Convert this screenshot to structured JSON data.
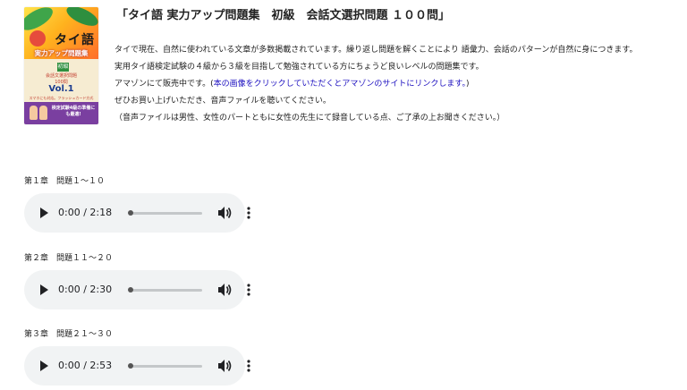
{
  "book": {
    "title_thai": "タイ語",
    "subtitle": "実力アップ問題集",
    "level": "初級",
    "description": "会話文選択問題",
    "count": "100問",
    "volume": "Vol.1",
    "note": "スマホにも対応。フラッシュカード方式",
    "band_text": "検定試験4級の準備にも最適!"
  },
  "header": {
    "title": "「タイ語 実力アップ問題集　初級　会話文選択問題 １００問」"
  },
  "description": {
    "line1": "タイで現在、自然に使われている文章が多数掲載されています。繰り返し問題を解くことにより 語彙力、会話のパターンが自然に身につきます。",
    "line2": "実用タイ語検定試験の４級から３級を目指して勉強されている方にちょうど良いレベルの問題集です。",
    "line3_prefix": "アマゾンにて販売中です。(",
    "line3_link": "本の画像をクリックしていただくとアマゾンのサイトにリンクします。",
    "line3_suffix": ")",
    "line4": "ぜひお買い上げいただき、音声ファイルを聴いてください。",
    "line5": "（音声ファイルは男性、女性のパートともに女性の先生にて録音している点、ご了承の上お聞きください。）"
  },
  "chapters": [
    {
      "label": "第１章　問題１～１０",
      "time_current": "0:00",
      "time_separator": "/",
      "time_total": "2:18",
      "progress": 0
    },
    {
      "label": "第２章　問題１１～２０",
      "time_current": "0:00",
      "time_separator": "/",
      "time_total": "2:30",
      "progress": 0
    },
    {
      "label": "第３章　問題２１～３０",
      "time_current": "0:00",
      "time_separator": "/",
      "time_total": "2:53",
      "progress": 0
    }
  ],
  "colors": {
    "link": "#1a0dbf",
    "player_bg": "#f1f3f4",
    "book_band": "#7a3fa0"
  },
  "icons": {
    "play": "play-icon",
    "volume": "volume-icon",
    "menu": "more-vert-icon"
  }
}
